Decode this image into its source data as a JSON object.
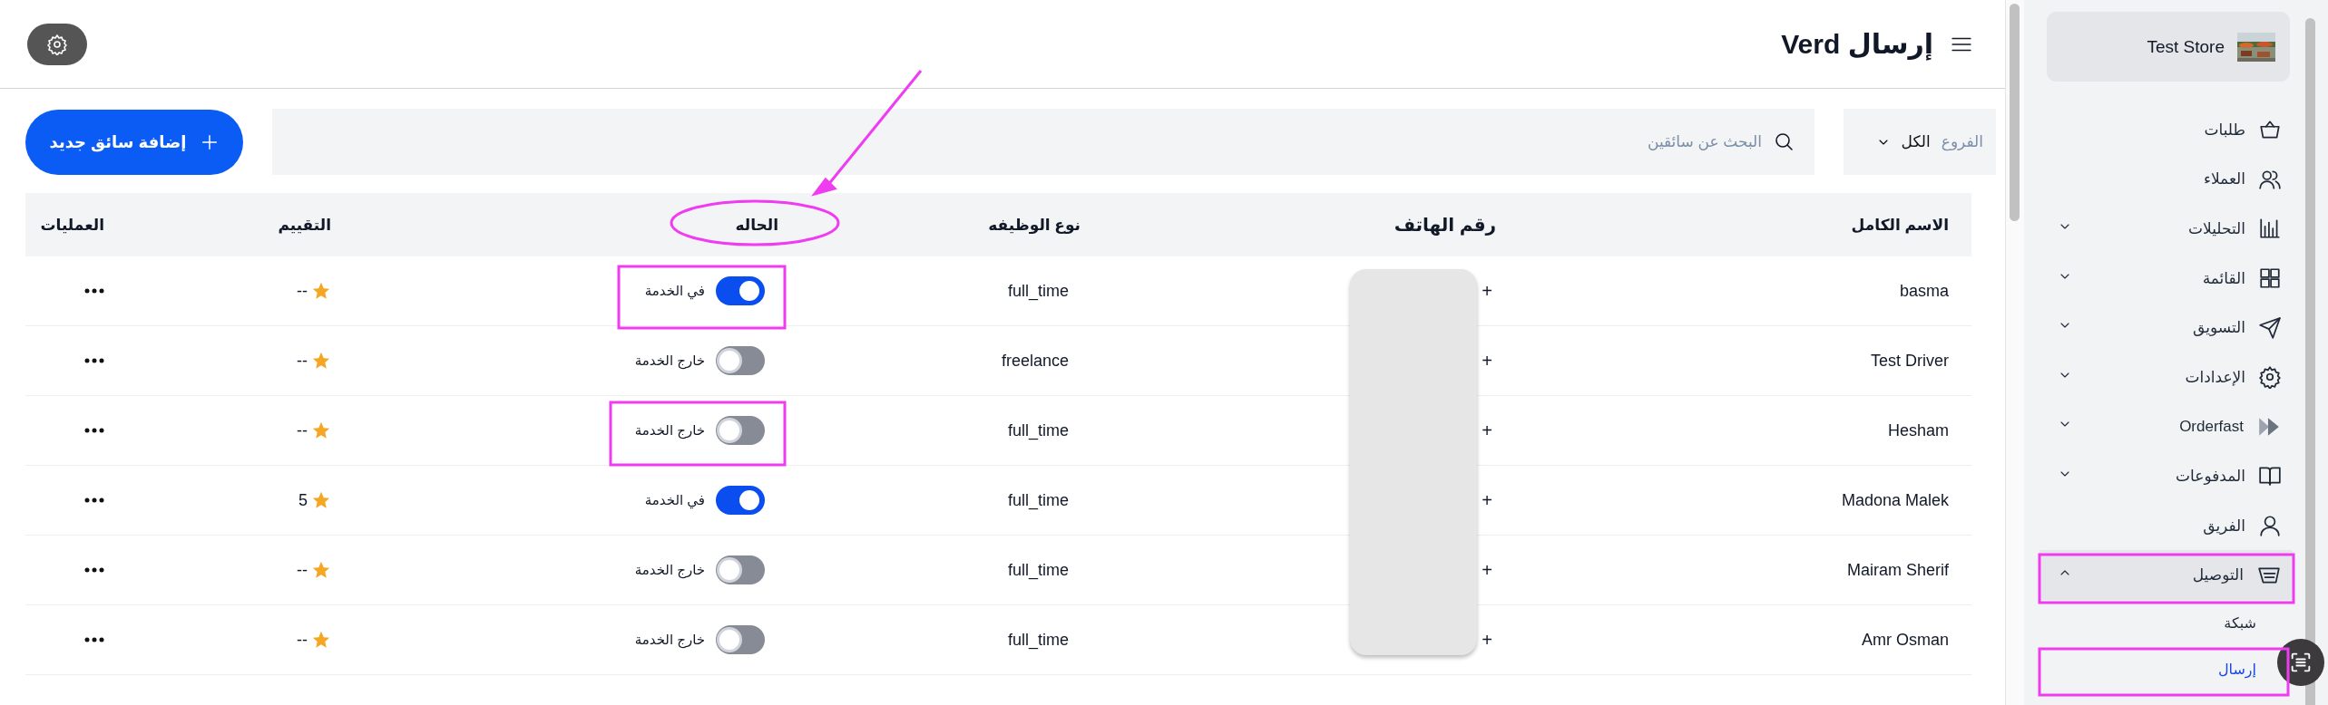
{
  "header": {
    "title": "إرسال Verd"
  },
  "toolbar": {
    "branch_label": "الفروع",
    "branch_value": "الكل",
    "search": {
      "placeholder": "البحث عن سائقين"
    },
    "add_button": "إضافة سائق جديد"
  },
  "table": {
    "columns": [
      "الاسم الكامل",
      "رقم الهاتف",
      "نوع الوظيفه",
      "الحاله",
      "التقييم",
      "العمليات"
    ],
    "rows": [
      {
        "name": "basma",
        "phone": "+",
        "job_type": "full_time",
        "on": true,
        "status": "في الخدمة",
        "rating": "--"
      },
      {
        "name": "Test Driver",
        "phone": "+",
        "job_type": "freelance",
        "on": false,
        "status": "خارج الخدمة",
        "rating": "--"
      },
      {
        "name": "Hesham",
        "phone": "+",
        "job_type": "full_time",
        "on": false,
        "status": "خارج الخدمة",
        "rating": "--"
      },
      {
        "name": "Madona Malek",
        "phone": "+",
        "job_type": "full_time",
        "on": true,
        "status": "في الخدمة",
        "rating": "5"
      },
      {
        "name": "Mairam Sherif",
        "phone": "+",
        "job_type": "full_time",
        "on": false,
        "status": "خارج الخدمة",
        "rating": "--"
      },
      {
        "name": "Amr Osman",
        "phone": "+",
        "job_type": "full_time",
        "on": false,
        "status": "خارج الخدمة",
        "rating": "--"
      }
    ]
  },
  "sidebar": {
    "store": "Test Store",
    "items": [
      {
        "label": "طلبات",
        "selected": false
      },
      {
        "label": "العملاء",
        "selected": false
      },
      {
        "label": "التحليلات",
        "selected": false,
        "expanded": false
      },
      {
        "label": "القائمة",
        "selected": false,
        "expanded": false
      },
      {
        "label": "التسويق",
        "selected": false,
        "expanded": false
      },
      {
        "label": "الإعدادات",
        "selected": false,
        "expanded": false
      },
      {
        "label": "Orderfast",
        "selected": false,
        "expanded": false
      },
      {
        "label": "المدفوعات",
        "selected": false,
        "expanded": false
      },
      {
        "label": "الفريق",
        "selected": false
      },
      {
        "label": "التوصيل",
        "selected": true,
        "expanded": true,
        "children": [
          {
            "label": "شبكة",
            "selected": false
          },
          {
            "label": "إرسال",
            "selected": true
          }
        ]
      }
    ]
  }
}
